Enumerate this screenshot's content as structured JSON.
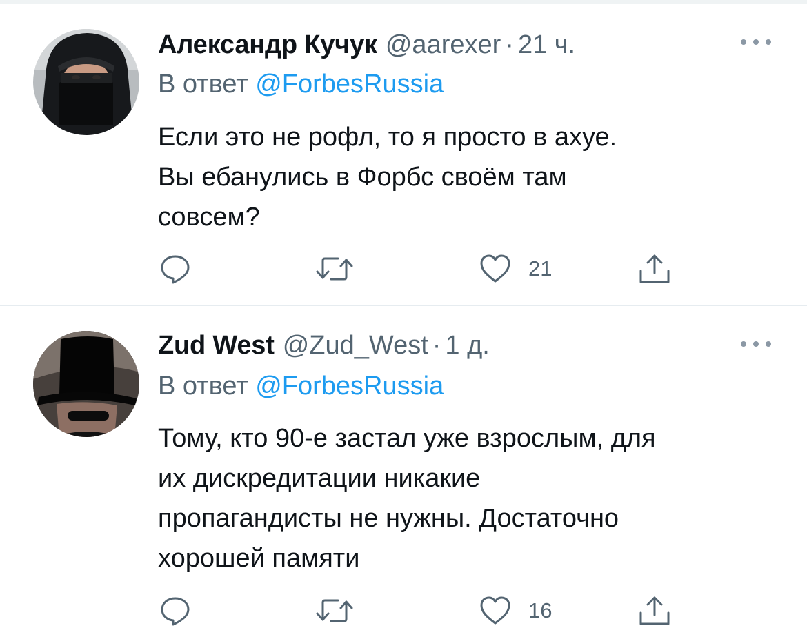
{
  "tweets": [
    {
      "author_name": "Александр Кучук",
      "author_handle": "@aarexer",
      "separator": "·",
      "timestamp": "21 ч.",
      "reply_prefix": "В ответ",
      "reply_to": "@ForbesRussia",
      "text_lines": [
        "Если это не рофл, то я просто в ахуе.",
        "Вы ебанулись в Форбс своём там",
        "совсем?"
      ],
      "like_count": "21",
      "icons": [
        "more-icon",
        "reply-icon",
        "retweet-icon",
        "like-icon",
        "share-icon"
      ]
    },
    {
      "author_name": "Zud West",
      "author_handle": "@Zud_West",
      "separator": "·",
      "timestamp": "1 д.",
      "reply_prefix": "В ответ",
      "reply_to": "@ForbesRussia",
      "text_lines": [
        "Тому, кто 90-е застал уже взрослым, для",
        "их дискредитации никакие",
        "пропагандисты не нужны. Достаточно",
        "хорошей памяти"
      ],
      "like_count": "16",
      "icons": [
        "more-icon",
        "reply-icon",
        "retweet-icon",
        "like-icon",
        "share-icon"
      ]
    }
  ],
  "colors": {
    "text_primary": "#0f1419",
    "text_secondary": "#536471",
    "link": "#1d9bf0",
    "divider": "#e6ecf0"
  }
}
